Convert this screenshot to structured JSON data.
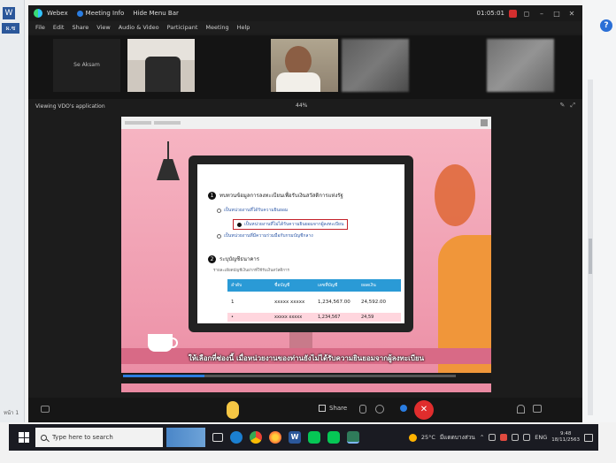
{
  "webex": {
    "title_items": [
      "Webex",
      "Meeting Info",
      "Hide Menu Bar"
    ],
    "timer": "01:05:01",
    "menu": [
      "File",
      "Edit",
      "Share",
      "View",
      "Audio & Video",
      "Participant",
      "Meeting",
      "Help"
    ],
    "participant_label": "Se Aksam",
    "viewing_label": "Viewing VDO's application",
    "zoom_level": "44%",
    "share_label": "Share"
  },
  "shared_content": {
    "step1_number": "1",
    "step1_title": "ทบทวนข้อมูลการลงทะเบียนเพื่อรับเงินสวัสดิการแห่งรัฐ",
    "step1_options": [
      "เป็นหน่วยงานที่ได้รับความยินยอม",
      "เป็นหน่วยงานที่ไม่ได้รับความยินยอมจากผู้ลงทะเบียน",
      "เป็นหน่วยงานที่มีความร่วมมือกับกรมบัญชีกลาง"
    ],
    "step2_number": "2",
    "step2_title": "ระบุบัญชีธนาคาร",
    "step2_note": "รายละเอียดบัญชีเงินฝากที่ใช้รับเงินสวัสดิการ",
    "table_headers": [
      "ลำดับ",
      "ชื่อบัญชี",
      "เลขที่บัญชี",
      "ยอดเงิน"
    ],
    "table_row_1": [
      "1",
      "xxxxx xxxxx",
      "1,234,567.00",
      "24,592.00"
    ],
    "table_row_2": [
      "•",
      "xxxxx xxxxx",
      "1,234,567",
      "24,59"
    ],
    "subtitle": "ให้เลือกที่ช่องนี้ เมื่อหน่วยงานของท่านยังไม่ได้รับความยินยอมจากผู้ลงทะเบียน"
  },
  "taskbar": {
    "search_placeholder": "Type here to search",
    "weather": "25°C",
    "weather_text": "มีแดดบางส่วน",
    "lang": "ENG",
    "time": "9:48",
    "date": "18/11/2563"
  },
  "side": {
    "word_badge": "W",
    "ribbon_stub": "ผ.ซ",
    "left_stub": "หน้า 1",
    "help": "?"
  }
}
